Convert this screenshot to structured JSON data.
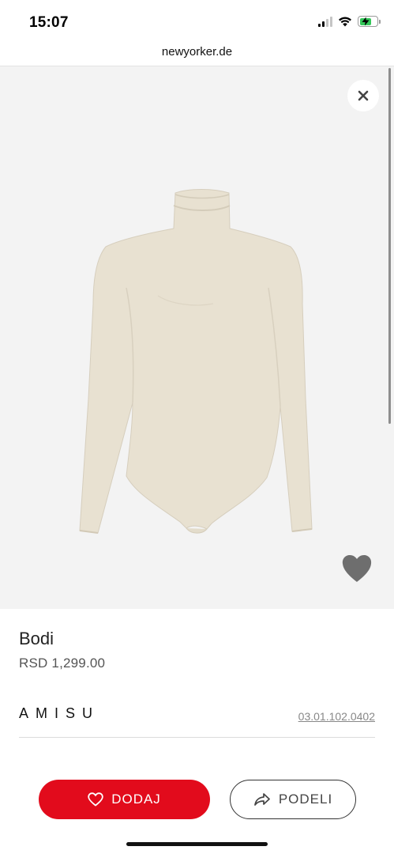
{
  "status_bar": {
    "time": "15:07",
    "signal_icon": "cellular-signal-icon",
    "wifi_icon": "wifi-icon",
    "battery_icon": "battery-charging-icon",
    "battery_color": "#34c759"
  },
  "browser": {
    "url": "newyorker.de"
  },
  "gallery": {
    "image_name": "turtleneck-bodysuit-image",
    "close_icon": "close-icon",
    "favorite_icon": "heart-icon",
    "background_color": "#f3f3f3"
  },
  "product": {
    "title": "Bodi",
    "price": "RSD 1,299.00",
    "brand": "AMISU",
    "article_number": "03.01.102.0402"
  },
  "actions": {
    "add_label": "DODAJ",
    "add_icon": "heart-outline-icon",
    "add_color": "#e20b1c",
    "share_label": "PODELI",
    "share_icon": "share-arrow-icon"
  }
}
